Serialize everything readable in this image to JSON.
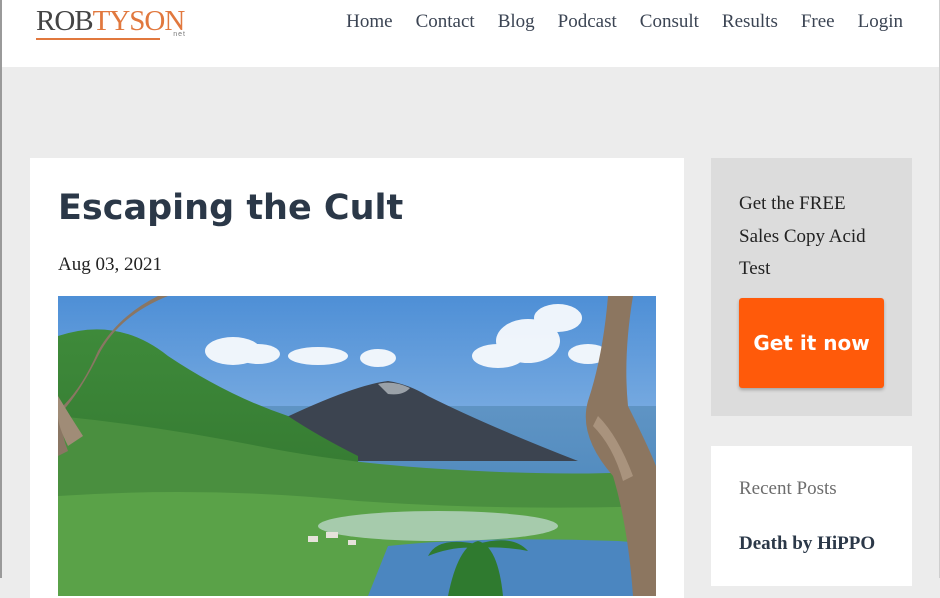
{
  "brand": {
    "logo_part1": "ROB",
    "logo_part2": "TYSON",
    "logo_sub": "net",
    "accent_color": "#e1783e"
  },
  "nav": {
    "items": [
      {
        "label": "Home"
      },
      {
        "label": "Contact"
      },
      {
        "label": "Blog"
      },
      {
        "label": "Podcast"
      },
      {
        "label": "Consult"
      },
      {
        "label": "Results"
      },
      {
        "label": "Free"
      },
      {
        "label": "Login"
      }
    ]
  },
  "post": {
    "title": "Escaping the Cult",
    "date": "Aug 03, 2021",
    "image": "volcano-island-landscape"
  },
  "sidebar": {
    "cta_text": "Get the FREE Sales Copy Acid Test",
    "cta_button": "Get it now",
    "cta_color": "#ff5a0a",
    "recent_heading": "Recent Posts",
    "recent_posts": [
      {
        "title": "Death by HiPPO"
      }
    ]
  }
}
